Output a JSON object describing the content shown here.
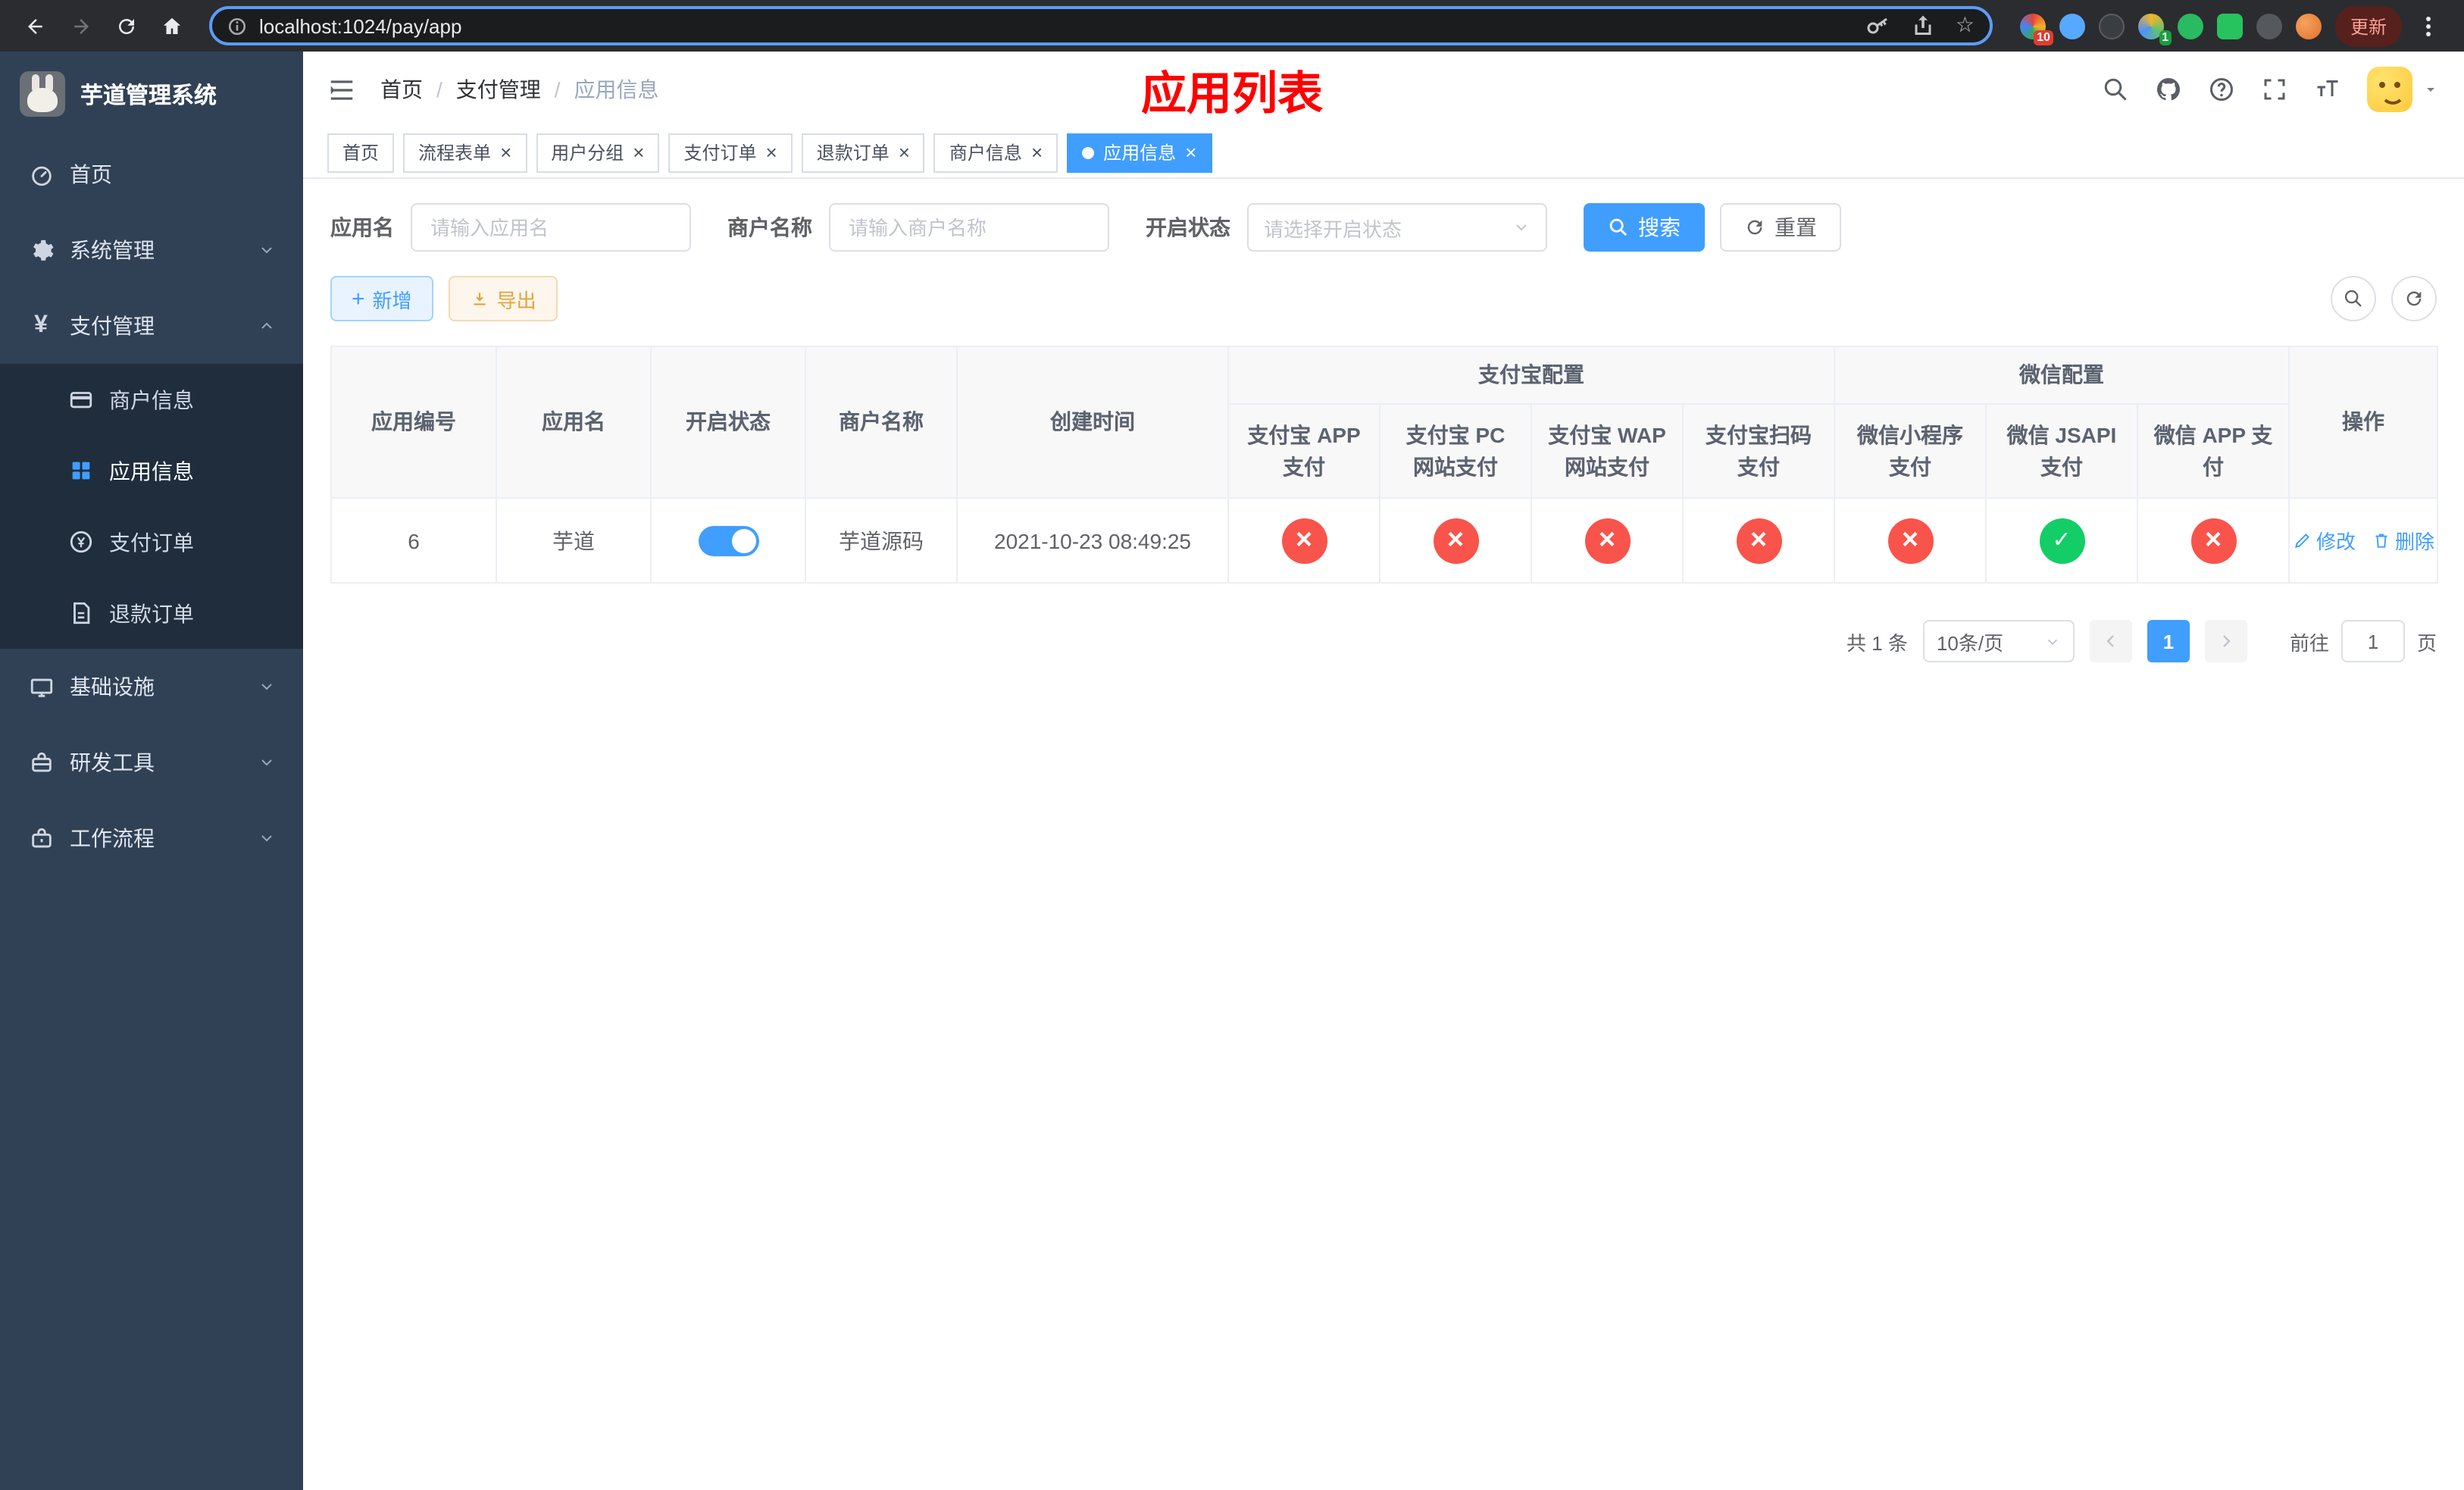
{
  "colors": {
    "accent": "#409eff",
    "success": "#13ce66",
    "danger": "#f9544b",
    "sidebar_bg": "#304156",
    "sidebar_sub_bg": "#1f2d3d",
    "title_red": "#fe0000"
  },
  "browser": {
    "url": "localhost:1024/pay/app",
    "update_label": "更新",
    "ext_badge_1": "10",
    "ext_badge_2": "1"
  },
  "sidebar": {
    "title": "芋道管理系统",
    "home": "首页",
    "system": "系统管理",
    "payment": "支付管理",
    "sub_merchant": "商户信息",
    "sub_app": "应用信息",
    "sub_pay_order": "支付订单",
    "sub_refund_order": "退款订单",
    "infra": "基础设施",
    "dev_tools": "研发工具",
    "workflow": "工作流程"
  },
  "header": {
    "breadcrumb": {
      "home": "首页",
      "section": "支付管理",
      "current": "应用信息"
    },
    "page_title": "应用列表"
  },
  "tabs": [
    {
      "label": "首页",
      "closable": false,
      "active": false
    },
    {
      "label": "流程表单",
      "closable": true,
      "active": false
    },
    {
      "label": "用户分组",
      "closable": true,
      "active": false
    },
    {
      "label": "支付订单",
      "closable": true,
      "active": false
    },
    {
      "label": "退款订单",
      "closable": true,
      "active": false
    },
    {
      "label": "商户信息",
      "closable": true,
      "active": false
    },
    {
      "label": "应用信息",
      "closable": true,
      "active": true
    }
  ],
  "filters": {
    "app_name_label": "应用名",
    "app_name_placeholder": "请输入应用名",
    "merchant_label": "商户名称",
    "merchant_placeholder": "请输入商户名称",
    "status_label": "开启状态",
    "status_placeholder": "请选择开启状态",
    "search_button": "搜索",
    "reset_button": "重置"
  },
  "toolbar": {
    "add_button": "新增",
    "export_button": "导出"
  },
  "table": {
    "group_headers": {
      "alipay": "支付宝配置",
      "wechat": "微信配置"
    },
    "columns": [
      "应用编号",
      "应用名",
      "开启状态",
      "商户名称",
      "创建时间",
      "支付宝 APP 支付",
      "支付宝 PC 网站支付",
      "支付宝 WAP 网站支付",
      "支付宝扫码支付",
      "微信小程序支付",
      "微信 JSAPI 支付",
      "微信 APP 支付",
      "操作"
    ],
    "rows": [
      {
        "id": "6",
        "name": "芋道",
        "enabled": true,
        "merchant": "芋道源码",
        "create_time": "2021-10-23 08:49:25",
        "alipay_app": false,
        "alipay_pc": false,
        "alipay_wap": false,
        "alipay_qr": false,
        "wechat_mini": false,
        "wechat_jsapi": true,
        "wechat_app": false,
        "edit_label": "修改",
        "delete_label": "删除"
      }
    ]
  },
  "pagination": {
    "total_label": "共 1 条",
    "page_size_label": "10条/页",
    "current_page": "1",
    "goto_prefix": "前往",
    "goto_value": "1",
    "goto_suffix": "页"
  }
}
